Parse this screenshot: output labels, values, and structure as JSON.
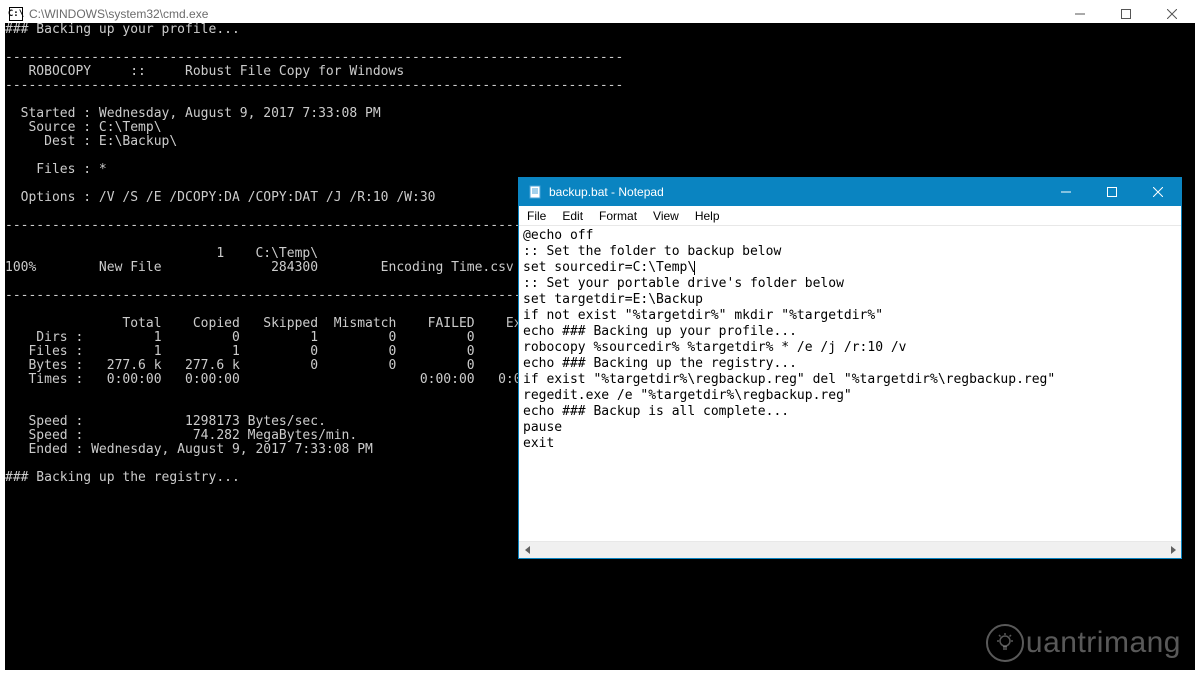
{
  "cmd": {
    "title_path": "C:\\WINDOWS\\system32\\cmd.exe",
    "icon_text": "C:\\",
    "output": "### Backing up your profile...\n\n-------------------------------------------------------------------------------\n   ROBOCOPY     ::     Robust File Copy for Windows\n-------------------------------------------------------------------------------\n\n  Started : Wednesday, August 9, 2017 7:33:08 PM\n   Source : C:\\Temp\\\n     Dest : E:\\Backup\\\n\n    Files : *\n\n  Options : /V /S /E /DCOPY:DA /COPY:DAT /J /R:10 /W:30\n\n------------------------------------------------------------------------------\n\n                           1    C:\\Temp\\\n100%        New File              284300        Encoding Time.csv\n\n------------------------------------------------------------------------------\n\n               Total    Copied   Skipped  Mismatch    FAILED    Extras\n    Dirs :         1         0         1         0         0         0\n   Files :         1         1         0         0         0         0\n   Bytes :   277.6 k   277.6 k         0         0         0         0\n   Times :   0:00:00   0:00:00                       0:00:00   0:00:00\n\n\n   Speed :             1298173 Bytes/sec.\n   Speed :              74.282 MegaBytes/min.\n   Ended : Wednesday, August 9, 2017 7:33:08 PM\n\n### Backing up the registry...\n"
  },
  "notepad": {
    "title": "backup.bat - Notepad",
    "menus": {
      "file": "File",
      "edit": "Edit",
      "format": "Format",
      "view": "View",
      "help": "Help"
    },
    "content_before_caret": "@echo off\n:: Set the folder to backup below\nset sourcedir=C:\\Temp\\",
    "content_after_caret": "\n:: Set your portable drive's folder below\nset targetdir=E:\\Backup\nif not exist \"%targetdir%\" mkdir \"%targetdir%\"\necho ### Backing up your profile...\nrobocopy %sourcedir% %targetdir% * /e /j /r:10 /v\necho ### Backing up the registry...\nif exist \"%targetdir%\\regbackup.reg\" del \"%targetdir%\\regbackup.reg\"\nregedit.exe /e \"%targetdir%\\regbackup.reg\"\necho ### Backup is all complete...\npause\nexit"
  },
  "watermark": {
    "text": "uantrimang"
  }
}
